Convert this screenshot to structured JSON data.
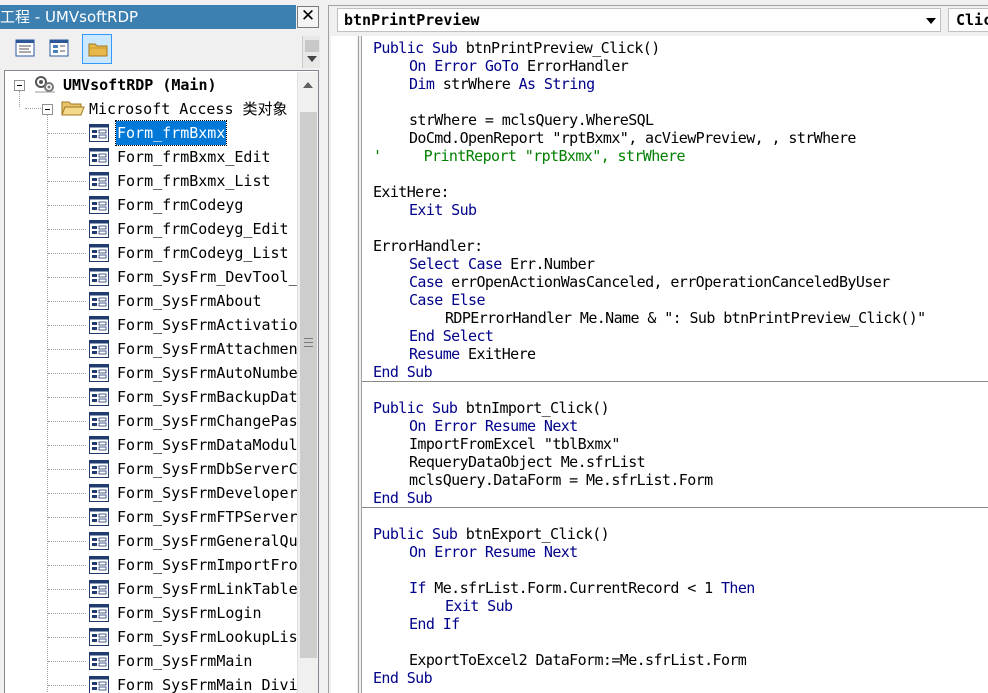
{
  "project": {
    "title": "工程 - UMVsoftRDP",
    "close_glyph": "✕",
    "toolbar": {
      "view_code": "view-code-icon",
      "view_object": "view-object-icon",
      "toggle_folders": "folder-icon"
    },
    "root": {
      "label": "UMVsoftRDP (Main)"
    },
    "folder": {
      "label": "Microsoft Access 类对象"
    },
    "items": [
      "Form_frmBxmx",
      "Form_frmBxmx_Edit",
      "Form_frmBxmx_List",
      "Form_frmCodeyg",
      "Form_frmCodeyg_Edit",
      "Form_frmCodeyg_List",
      "Form_SysFrm_DevTool_",
      "Form_SysFrmAbout",
      "Form_SysFrmActivatio",
      "Form_SysFrmAttachmen",
      "Form_SysFrmAutoNumbe",
      "Form_SysFrmBackupDat",
      "Form_SysFrmChangePas",
      "Form_SysFrmDataModul",
      "Form_SysFrmDbServerC",
      "Form_SysFrmDeveloper",
      "Form_SysFrmFTPServer",
      "Form_SysFrmGeneralQu",
      "Form_SysFrmImportFro",
      "Form_SysFrmLinkTable",
      "Form_SysFrmLogin",
      "Form_SysFrmLookupLis",
      "Form_SysFrmMain",
      "Form_SysFrmMain_Divi"
    ],
    "selected_index": 0
  },
  "code_window": {
    "object_combo": "btnPrintPreview",
    "procedure_combo": "Click",
    "lines": [
      {
        "indent": 0,
        "parts": [
          [
            "kw",
            "Public Sub "
          ],
          [
            "",
            "btnPrintPreview_Click()"
          ]
        ]
      },
      {
        "indent": 1,
        "parts": [
          [
            "kw",
            "On Error GoTo "
          ],
          [
            "",
            "ErrorHandler"
          ]
        ]
      },
      {
        "indent": 1,
        "parts": [
          [
            "kw",
            "Dim "
          ],
          [
            "",
            "strWhere "
          ],
          [
            "kw",
            "As String"
          ]
        ]
      },
      {
        "indent": 0,
        "parts": []
      },
      {
        "indent": 1,
        "parts": [
          [
            "",
            "strWhere = mclsQuery.WhereSQL"
          ]
        ]
      },
      {
        "indent": 1,
        "parts": [
          [
            "",
            "DoCmd.OpenReport \"rptBxmx\", acViewPreview, , strWhere"
          ]
        ]
      },
      {
        "indent": 0,
        "parts": [
          [
            "cm",
            "'     PrintReport \"rptBxmx\", strWhere"
          ]
        ]
      },
      {
        "indent": 0,
        "parts": []
      },
      {
        "indent": 0,
        "parts": [
          [
            "",
            "ExitHere:"
          ]
        ]
      },
      {
        "indent": 1,
        "parts": [
          [
            "kw",
            "Exit Sub"
          ]
        ]
      },
      {
        "indent": 0,
        "parts": []
      },
      {
        "indent": 0,
        "parts": [
          [
            "",
            "ErrorHandler:"
          ]
        ]
      },
      {
        "indent": 1,
        "parts": [
          [
            "kw",
            "Select Case "
          ],
          [
            "",
            "Err.Number"
          ]
        ]
      },
      {
        "indent": 1,
        "parts": [
          [
            "kw",
            "Case "
          ],
          [
            "",
            "errOpenActionWasCanceled, errOperationCanceledByUser"
          ]
        ]
      },
      {
        "indent": 1,
        "parts": [
          [
            "kw",
            "Case Else"
          ]
        ]
      },
      {
        "indent": 2,
        "parts": [
          [
            "",
            "RDPErrorHandler Me.Name & \": Sub btnPrintPreview_Click()\""
          ]
        ]
      },
      {
        "indent": 1,
        "parts": [
          [
            "kw",
            "End Select"
          ]
        ]
      },
      {
        "indent": 1,
        "parts": [
          [
            "kw",
            "Resume "
          ],
          [
            "",
            "ExitHere"
          ]
        ]
      },
      {
        "indent": 0,
        "parts": [
          [
            "kw",
            "End Sub"
          ]
        ],
        "sep_after": true
      },
      {
        "indent": 0,
        "parts": []
      },
      {
        "indent": 0,
        "parts": [
          [
            "kw",
            "Public Sub "
          ],
          [
            "",
            "btnImport_Click()"
          ]
        ]
      },
      {
        "indent": 1,
        "parts": [
          [
            "kw",
            "On Error Resume Next"
          ]
        ]
      },
      {
        "indent": 1,
        "parts": [
          [
            "",
            "ImportFromExcel \"tblBxmx\""
          ]
        ]
      },
      {
        "indent": 1,
        "parts": [
          [
            "",
            "RequeryDataObject Me.sfrList"
          ]
        ]
      },
      {
        "indent": 1,
        "parts": [
          [
            "",
            "mclsQuery.DataForm = Me.sfrList.Form"
          ]
        ]
      },
      {
        "indent": 0,
        "parts": [
          [
            "kw",
            "End Sub"
          ]
        ],
        "sep_after": true
      },
      {
        "indent": 0,
        "parts": []
      },
      {
        "indent": 0,
        "parts": [
          [
            "kw",
            "Public Sub "
          ],
          [
            "",
            "btnExport_Click()"
          ]
        ]
      },
      {
        "indent": 1,
        "parts": [
          [
            "kw",
            "On Error Resume Next"
          ]
        ]
      },
      {
        "indent": 0,
        "parts": []
      },
      {
        "indent": 1,
        "parts": [
          [
            "kw",
            "If "
          ],
          [
            "",
            "Me.sfrList.Form.CurrentRecord < 1 "
          ],
          [
            "kw",
            "Then"
          ]
        ]
      },
      {
        "indent": 2,
        "parts": [
          [
            "kw",
            "Exit Sub"
          ]
        ]
      },
      {
        "indent": 1,
        "parts": [
          [
            "kw",
            "End If"
          ]
        ]
      },
      {
        "indent": 0,
        "parts": []
      },
      {
        "indent": 1,
        "parts": [
          [
            "",
            "ExportToExcel2 DataForm:=Me.sfrList.Form"
          ]
        ]
      },
      {
        "indent": 0,
        "parts": [
          [
            "kw",
            "End Sub"
          ]
        ]
      }
    ]
  },
  "colors": {
    "keyword": "#00008b",
    "comment": "#008000",
    "selection": "#0078d7",
    "titlebar": "#3c7fb1"
  }
}
